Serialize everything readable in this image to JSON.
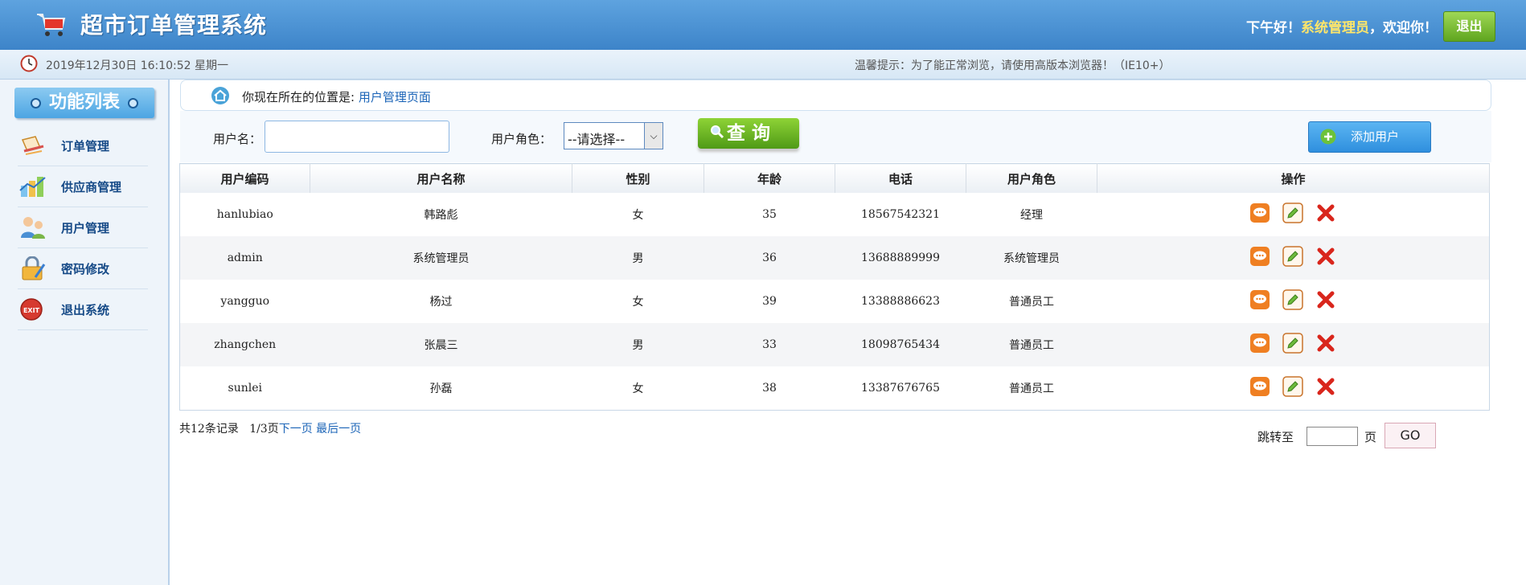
{
  "header": {
    "title": "超市订单管理系统",
    "greeting_prefix": "下午好！",
    "user_name": "系统管理员",
    "greeting_suffix": "，欢迎你！",
    "logout_label": "退出"
  },
  "subbar": {
    "datetime": "2019年12月30日 16:10:52 星期一",
    "tip": "温馨提示：为了能正常浏览，请使用高版本浏览器！（IE10+）"
  },
  "sidebar": {
    "title": "功能列表",
    "items": [
      {
        "label": "订单管理",
        "icon": "order-icon"
      },
      {
        "label": "供应商管理",
        "icon": "supplier-icon"
      },
      {
        "label": "用户管理",
        "icon": "users-icon"
      },
      {
        "label": "密码修改",
        "icon": "lock-icon"
      },
      {
        "label": "退出系统",
        "icon": "exit-icon"
      }
    ]
  },
  "breadcrumb": {
    "prefix": "你现在所在的位置是: ",
    "current": "用户管理页面"
  },
  "search": {
    "username_label": "用户名：",
    "username_value": "",
    "role_label": "用户角色：",
    "role_selected": "--请选择--",
    "query_label": "查 询",
    "add_label": "添加用户"
  },
  "table": {
    "columns": [
      "用户编码",
      "用户名称",
      "性别",
      "年龄",
      "电话",
      "用户角色",
      "操作"
    ],
    "rows": [
      {
        "code": "hanlubiao",
        "name": "韩路彪",
        "gender": "女",
        "age": "35",
        "phone": "18567542321",
        "role": "经理"
      },
      {
        "code": "admin",
        "name": "系统管理员",
        "gender": "男",
        "age": "36",
        "phone": "13688889999",
        "role": "系统管理员"
      },
      {
        "code": "yangguo",
        "name": "杨过",
        "gender": "女",
        "age": "39",
        "phone": "13388886623",
        "role": "普通员工"
      },
      {
        "code": "zhangchen",
        "name": "张晨三",
        "gender": "男",
        "age": "33",
        "phone": "18098765434",
        "role": "普通员工"
      },
      {
        "code": "sunlei",
        "name": "孙磊",
        "gender": "女",
        "age": "38",
        "phone": "13387676765",
        "role": "普通员工"
      }
    ]
  },
  "pagination": {
    "total": "共12条记录",
    "page": "1/3页",
    "next": "下一页",
    "last": "最后一页",
    "jump_label": "跳转至",
    "jump_value": "",
    "jump_unit": "页",
    "go_label": "GO"
  },
  "colors": {
    "header_blue": "#3d84c9",
    "link_blue": "#1b64b7",
    "green_button": "#5fa51f",
    "highlight_yellow": "#ffe66a"
  }
}
